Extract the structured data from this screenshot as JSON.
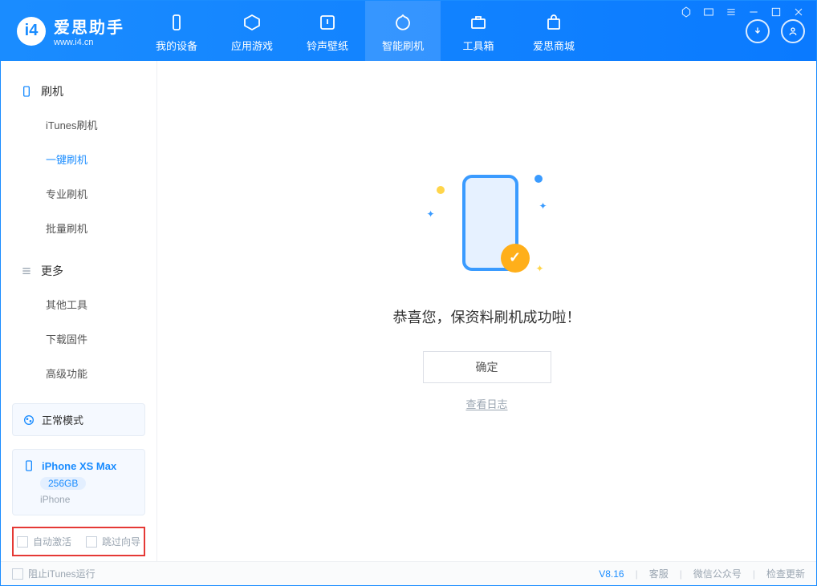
{
  "app": {
    "title": "爱思助手",
    "subtitle": "www.i4.cn"
  },
  "nav": {
    "items": [
      {
        "label": "我的设备",
        "icon": "device-icon"
      },
      {
        "label": "应用游戏",
        "icon": "apps-icon"
      },
      {
        "label": "铃声壁纸",
        "icon": "music-icon"
      },
      {
        "label": "智能刷机",
        "icon": "flash-icon"
      },
      {
        "label": "工具箱",
        "icon": "toolbox-icon"
      },
      {
        "label": "爱思商城",
        "icon": "shop-icon"
      }
    ]
  },
  "sidebar": {
    "group1": {
      "title": "刷机",
      "items": [
        "iTunes刷机",
        "一键刷机",
        "专业刷机",
        "批量刷机"
      ]
    },
    "group2": {
      "title": "更多",
      "items": [
        "其他工具",
        "下载固件",
        "高级功能"
      ]
    },
    "mode_card": "正常模式",
    "device": {
      "name": "iPhone XS Max",
      "capacity": "256GB",
      "type": "iPhone"
    },
    "option1": "自动激活",
    "option2": "跳过向导"
  },
  "main": {
    "success_text": "恭喜您，保资料刷机成功啦！",
    "ok_label": "确定",
    "log_link": "查看日志"
  },
  "footer": {
    "block_itunes": "阻止iTunes运行",
    "version": "V8.16",
    "support": "客服",
    "wechat": "微信公众号",
    "update": "检查更新"
  }
}
